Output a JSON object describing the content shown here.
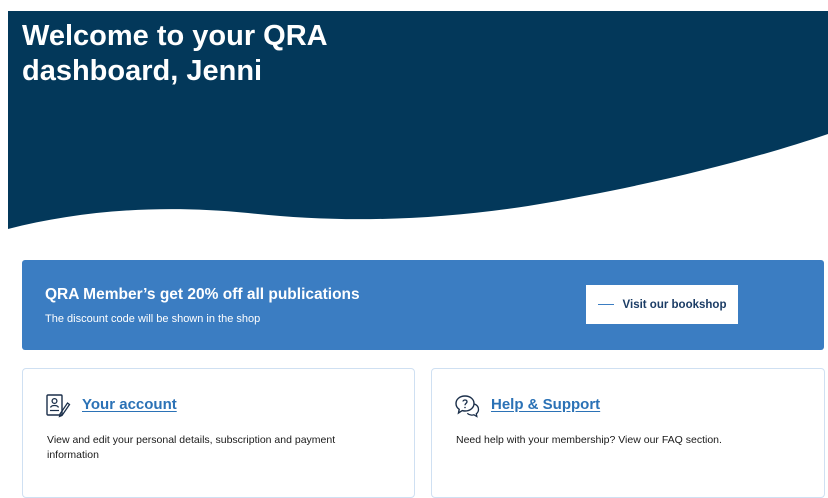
{
  "hero": {
    "title": "Welcome to your QRA dashboard, Jenni",
    "background_color": "#03385a"
  },
  "promo": {
    "title": "QRA Member’s get 20% off all publications",
    "subtitle": "The discount code will be shown in the shop",
    "button_label": "Visit our bookshop",
    "background_color": "#3b7dc2"
  },
  "cards": [
    {
      "icon": "account-document-icon",
      "title": "Your account",
      "description": "View and edit your personal details, subscription and payment information"
    },
    {
      "icon": "help-chat-icon",
      "title": "Help & Support",
      "description": "Need help with your membership? View our FAQ section."
    }
  ]
}
